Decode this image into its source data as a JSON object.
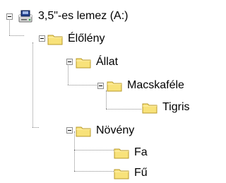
{
  "tree": {
    "nodes": [
      {
        "label": "3,5\"-es lemez (A:)",
        "icon": "floppy-drive-icon",
        "expanded": true
      },
      {
        "label": "Élőlény",
        "icon": "folder-icon",
        "expanded": true
      },
      {
        "label": "Állat",
        "icon": "folder-icon",
        "expanded": true
      },
      {
        "label": "Macskaféle",
        "icon": "folder-icon",
        "expanded": true
      },
      {
        "label": "Tigris",
        "icon": "folder-icon",
        "expanded": false
      },
      {
        "label": "Növény",
        "icon": "folder-icon",
        "expanded": true
      },
      {
        "label": "Fa",
        "icon": "folder-icon",
        "expanded": false
      },
      {
        "label": "Fű",
        "icon": "folder-icon",
        "expanded": false
      }
    ]
  },
  "colors": {
    "folder_fill": "#f8e27a",
    "folder_edge": "#b89a2a",
    "connector": "#8a8a8a"
  }
}
